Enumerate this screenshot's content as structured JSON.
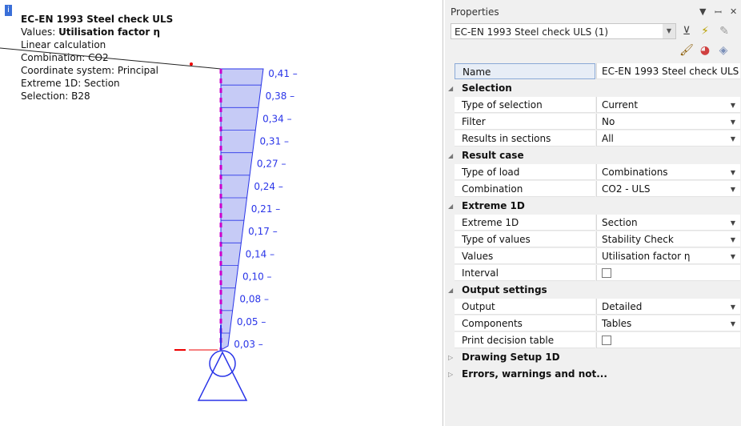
{
  "canvas": {
    "info_lines": {
      "line1": "EC-EN  1993 Steel check ULS",
      "values_prefix": "Values: ",
      "values_value": "Utilisation  factor η",
      "line3": "Linear calculation",
      "line4": "Combination:  CO2",
      "line5": "Coordinate system: Principal",
      "line6": "Extreme 1D: Section",
      "line7": "Selection: B28"
    },
    "diagram_labels": [
      "0,41",
      "0,38",
      "0,34",
      "0,31",
      "0,27",
      "0,24",
      "0,21",
      "0,17",
      "0,14",
      "0,10",
      "0,08",
      "0,05",
      "0,03"
    ],
    "colors": {
      "fill": "#c6cbf6",
      "line": "#2a35e8",
      "member": "#cc00cc",
      "support": "#2a35e8"
    }
  },
  "properties": {
    "title": "Properties",
    "pin_icon": "pin-icon",
    "close_icon": "close-icon",
    "object_select": "EC-EN 1993 Steel check ULS (1)",
    "rows": {
      "name": {
        "label": "Name",
        "value": "EC-EN 1993 Steel check ULS"
      },
      "selection": "Selection",
      "type_of_selection": {
        "label": "Type of selection",
        "value": "Current"
      },
      "filter": {
        "label": "Filter",
        "value": "No"
      },
      "results_in_sections": {
        "label": "Results in sections",
        "value": "All"
      },
      "result_case": "Result case",
      "type_of_load": {
        "label": "Type of load",
        "value": "Combinations"
      },
      "combination": {
        "label": "Combination",
        "value": "CO2 - ULS"
      },
      "extreme_1d_group": "Extreme 1D",
      "extreme_1d": {
        "label": "Extreme 1D",
        "value": "Section"
      },
      "type_of_values": {
        "label": "Type of values",
        "value": "Stability Check"
      },
      "values": {
        "label": "Values",
        "value": "Utilisation factor η"
      },
      "interval": {
        "label": "Interval"
      },
      "output_settings": "Output settings",
      "output": {
        "label": "Output",
        "value": "Detailed"
      },
      "components": {
        "label": "Components",
        "value": "Tables"
      },
      "print_decision_table": {
        "label": "Print decision table"
      },
      "drawing_setup": "Drawing Setup 1D",
      "errors": "Errors, warnings and not..."
    }
  }
}
